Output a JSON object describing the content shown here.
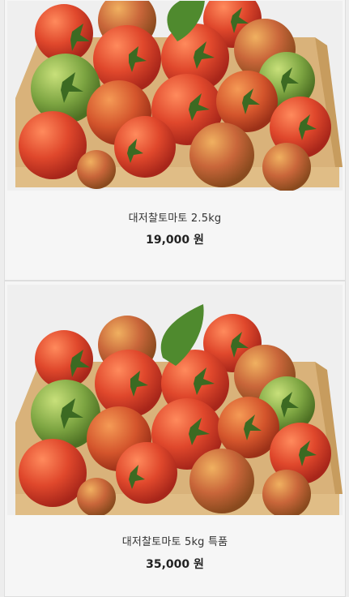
{
  "products": [
    {
      "name": "대저찰토마토 2.5kg",
      "price": "19,000 원",
      "image": "tomato-box-photo"
    },
    {
      "name": "대저찰토마토 5kg 특품",
      "price": "35,000 원",
      "image": "tomato-box-photo"
    }
  ],
  "colors": {
    "card_background": "#f6f6f6",
    "tomato_red": "#d8452e",
    "tomato_green": "#7da542",
    "box_cardboard": "#d6b07a"
  }
}
